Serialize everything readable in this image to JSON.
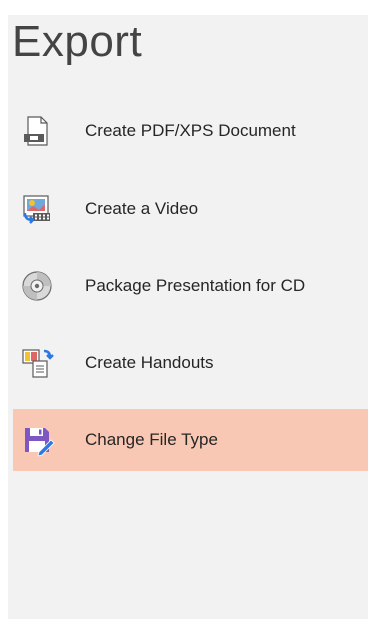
{
  "header": {
    "title": "Export"
  },
  "items": [
    {
      "label": "Create PDF/XPS Document",
      "icon": "pdf-document-icon",
      "selected": false
    },
    {
      "label": "Create a Video",
      "icon": "video-icon",
      "selected": false
    },
    {
      "label": "Package Presentation for CD",
      "icon": "cd-disc-icon",
      "selected": false
    },
    {
      "label": "Create Handouts",
      "icon": "handouts-icon",
      "selected": false
    },
    {
      "label": "Change File Type",
      "icon": "save-file-type-icon",
      "selected": true
    }
  ],
  "colors": {
    "panel_background": "#f2f2f2",
    "selected_background": "#f9c8b4",
    "title_text": "#444444",
    "item_text": "#262626"
  }
}
